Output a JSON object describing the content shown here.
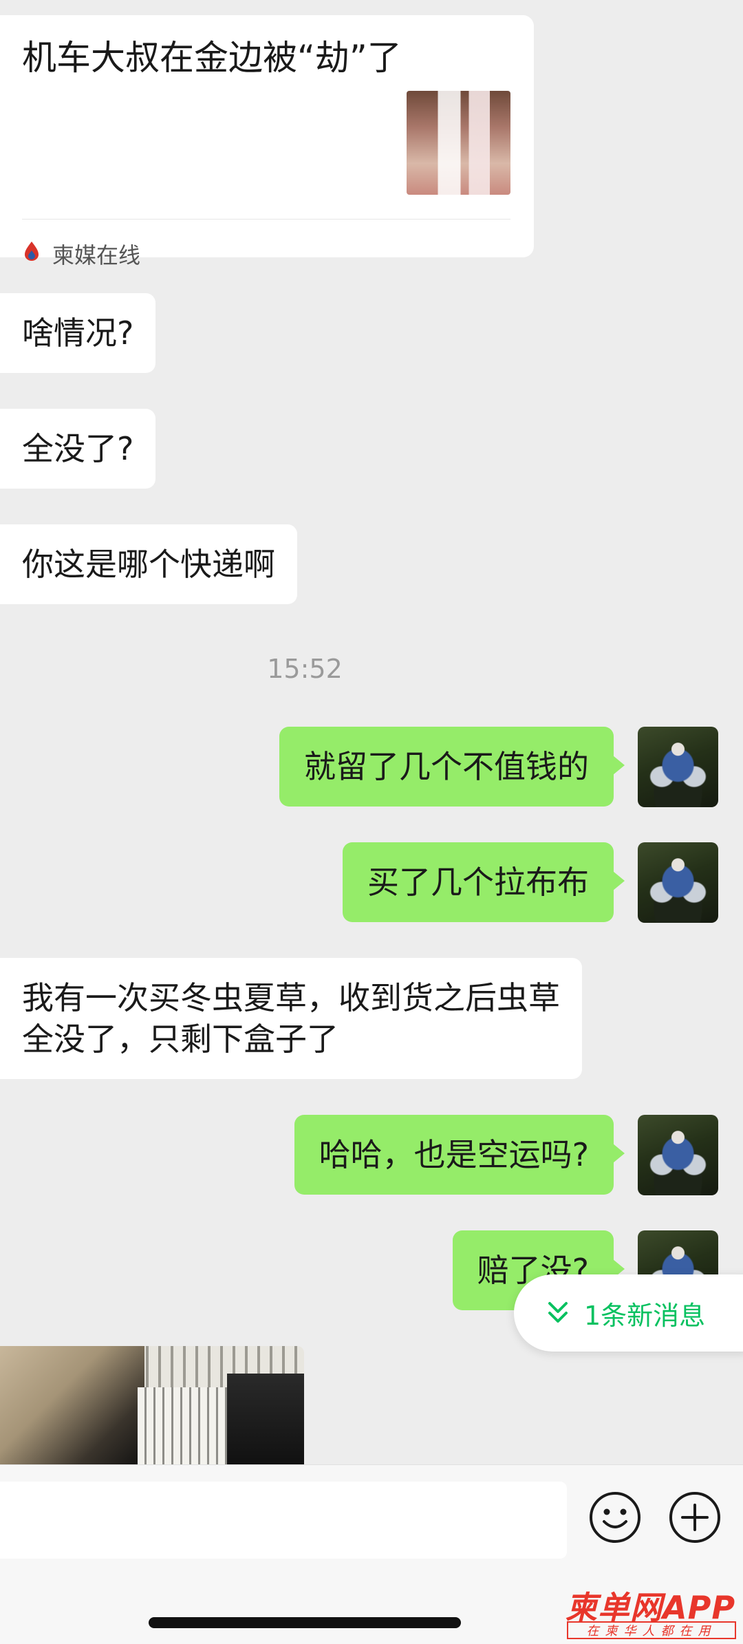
{
  "link_card": {
    "title": "机车大叔在金边被“劫”了",
    "source": "柬媒在线"
  },
  "messages_top": [
    {
      "text": "啥情况?"
    },
    {
      "text": "全没了?"
    },
    {
      "text": "你这是哪个快递啊"
    }
  ],
  "timestamp": "15:52",
  "outgoing": [
    {
      "text": "就留了几个不值钱的"
    },
    {
      "text": "买了几个拉布布"
    },
    {
      "text": "哈哈，也是空运吗?"
    },
    {
      "text": "赔了没?"
    }
  ],
  "incoming_long": "我有一次买冬虫夏草，收到货之后虫草全没了，只剩下盒子了",
  "new_message_pill": "1条新消息",
  "input_bar": {
    "emoji_icon": "smiley-icon",
    "plus_icon": "plus-circle-icon"
  },
  "watermark": {
    "logo_text": "柬单网APP",
    "tagline": "在柬华人都在用"
  },
  "colors": {
    "background": "#ededed",
    "outgoing_bubble": "#95ec69",
    "incoming_bubble": "#ffffff",
    "accent_green": "#07c160",
    "watermark_red": "#e8362b"
  }
}
